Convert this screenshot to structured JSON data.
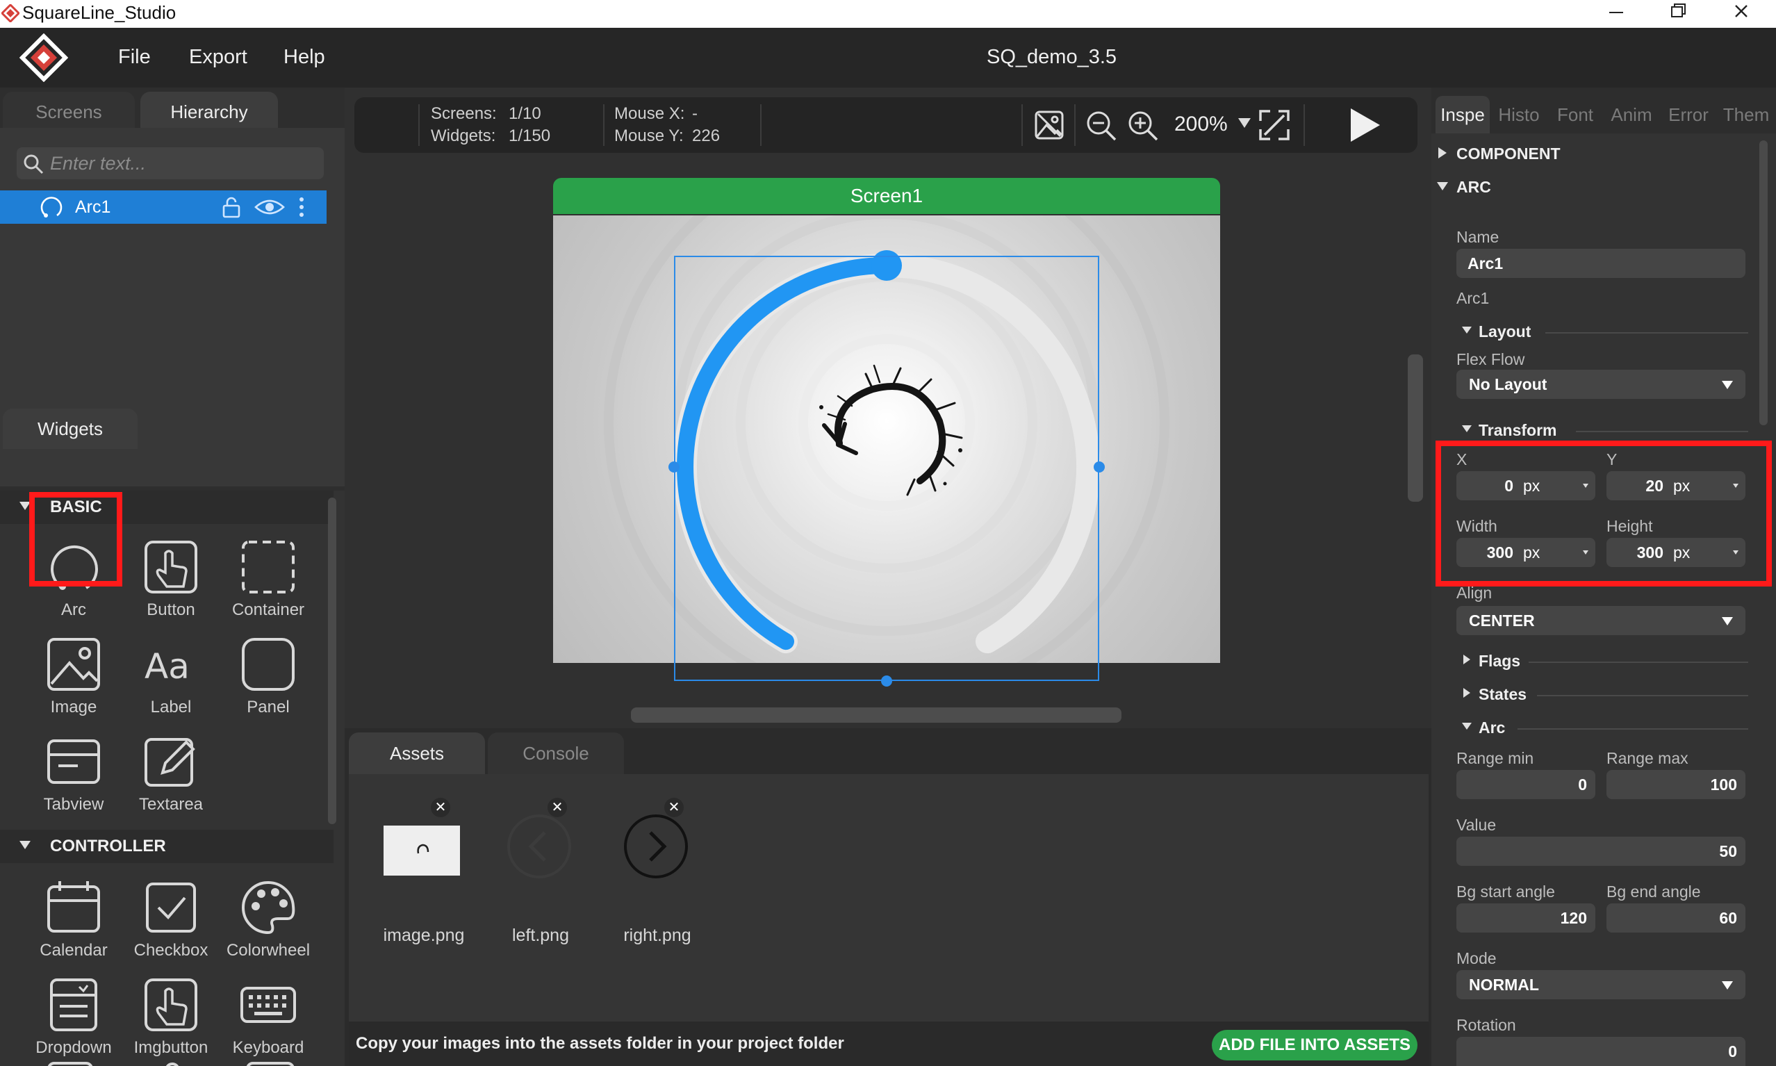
{
  "window": {
    "title": "SquareLine_Studio"
  },
  "menu": {
    "items": [
      "File",
      "Export",
      "Help"
    ],
    "project_title": "SQ_demo_3.5"
  },
  "left_panel": {
    "tabs": [
      "Screens",
      "Hierarchy"
    ],
    "search_placeholder": "Enter text...",
    "hierarchy_items": [
      {
        "label": "Arc1"
      }
    ],
    "widgets_tab": "Widgets",
    "sections": [
      {
        "title": "BASIC",
        "items": [
          "Arc",
          "Button",
          "Container",
          "Image",
          "Label",
          "Panel",
          "Tabview",
          "Textarea"
        ]
      },
      {
        "title": "CONTROLLER",
        "items": [
          "Calendar",
          "Checkbox",
          "Colorwheel",
          "Dropdown",
          "Imgbutton",
          "Keyboard"
        ]
      }
    ]
  },
  "toolbar": {
    "screens_label": "Screens:",
    "screens_value": "1/10",
    "widgets_label": "Widgets:",
    "widgets_value": "1/150",
    "mouse_x_label": "Mouse X:",
    "mouse_x_value": "-",
    "mouse_y_label": "Mouse Y:",
    "mouse_y_value": "226",
    "zoom": "200%"
  },
  "canvas": {
    "screen_name": "Screen1",
    "arc_value_fraction": 0.5
  },
  "assets_panel": {
    "tabs": [
      "Assets",
      "Console"
    ],
    "files": [
      "image.png",
      "left.png",
      "right.png"
    ],
    "footer_message": "Copy your images into the assets folder in your project folder",
    "add_button": "ADD FILE INTO ASSETS"
  },
  "inspector": {
    "tabs": [
      "Inspe",
      "Histo",
      "Font",
      "Anim",
      "Error",
      "Them"
    ],
    "component_section": "COMPONENT",
    "arc_section": "ARC",
    "name_label": "Name",
    "name_value": "Arc1",
    "type_label": "Arc1",
    "layout_section": "Layout",
    "flex_flow_label": "Flex Flow",
    "flex_flow_value": "No Layout",
    "transform_section": "Transform",
    "x_label": "X",
    "x_value": "0",
    "x_unit": "px",
    "y_label": "Y",
    "y_value": "20",
    "y_unit": "px",
    "width_label": "Width",
    "width_value": "300",
    "width_unit": "px",
    "height_label": "Height",
    "height_value": "300",
    "height_unit": "px",
    "align_label": "Align",
    "align_value": "CENTER",
    "flags_section": "Flags",
    "states_section": "States",
    "arc_sub_section": "Arc",
    "range_min_label": "Range min",
    "range_min_value": "0",
    "range_max_label": "Range max",
    "range_max_value": "100",
    "value_label": "Value",
    "value_value": "50",
    "bg_start_label": "Bg start angle",
    "bg_start_value": "120",
    "bg_end_label": "Bg end angle",
    "bg_end_value": "60",
    "mode_label": "Mode",
    "mode_value": "NORMAL",
    "rotation_label": "Rotation",
    "rotation_value": "0"
  },
  "colors": {
    "accent_blue": "#1f7fd6",
    "arc_blue": "#2196f3",
    "green": "#2aa14a",
    "highlight_red": "#ff1a1a"
  }
}
